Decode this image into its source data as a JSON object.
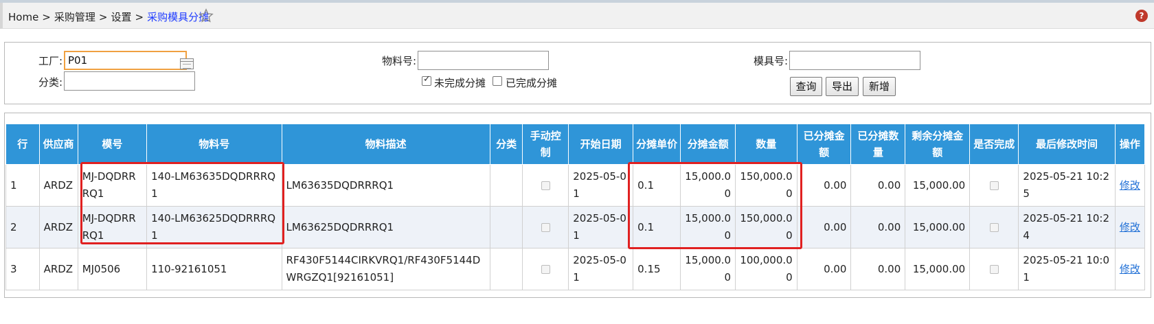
{
  "breadcrumb": {
    "items": [
      "Home",
      "采购管理",
      "设置"
    ],
    "current": "采购模具分摊",
    "separator": ">"
  },
  "filters": {
    "factory_label": "工厂:",
    "factory_value": "P01",
    "category_label": "分类:",
    "category_value": "",
    "material_label": "物料号:",
    "material_value": "",
    "mold_label": "模具号:",
    "mold_value": "",
    "unfinished_label": "未完成分摊",
    "unfinished_checked": true,
    "finished_label": "已完成分摊",
    "finished_checked": false
  },
  "buttons": {
    "query": "查询",
    "export": "导出",
    "add": "新增"
  },
  "table": {
    "headers": [
      "行",
      "供应商",
      "模号",
      "物料号",
      "物料描述",
      "分类",
      "手动控制",
      "开始日期",
      "分摊单价",
      "分摊金额",
      "数量",
      "已分摊金额",
      "已分摊数量",
      "剩余分摊金额",
      "是否完成",
      "最后修改时间",
      "操作"
    ],
    "rows": [
      {
        "row": "1",
        "supplier": "ARDZ",
        "mold": "MJ-DQDRRRQ1",
        "material": "140-LM63635DQDRRRQ1",
        "desc": "LM63635DQDRRRQ1",
        "category": "",
        "start": "2025-05-01",
        "unit_price": "0.1",
        "amount": "15,000.00",
        "qty": "150,000.00",
        "alloc_amount": "0.00",
        "alloc_qty": "0.00",
        "remain": "15,000.00",
        "modified": "2025-05-21 10:25",
        "action": "修改"
      },
      {
        "row": "2",
        "supplier": "ARDZ",
        "mold": "MJ-DQDRRRQ1",
        "material": "140-LM63625DQDRRRQ1",
        "desc": "LM63625DQDRRRQ1",
        "category": "",
        "start": "2025-05-01",
        "unit_price": "0.1",
        "amount": "15,000.00",
        "qty": "150,000.00",
        "alloc_amount": "0.00",
        "alloc_qty": "0.00",
        "remain": "15,000.00",
        "modified": "2025-05-21 10:24",
        "action": "修改"
      },
      {
        "row": "3",
        "supplier": "ARDZ",
        "mold": "MJ0506",
        "material": "110-92161051",
        "desc": "RF430F5144CIRKVRQ1/RF430F5144DWRGZQ1[92161051]",
        "category": "",
        "start": "2025-05-01",
        "unit_price": "0.15",
        "amount": "15,000.00",
        "qty": "100,000.00",
        "alloc_amount": "0.00",
        "alloc_qty": "0.00",
        "remain": "15,000.00",
        "modified": "2025-05-21 10:01",
        "action": "修改"
      }
    ]
  },
  "icons": {
    "star": "star-icon",
    "help": "help-icon",
    "calendar": "calendar-icon"
  },
  "colors": {
    "header_bg": "#2f95d8",
    "link": "#1f3cff",
    "highlight_border": "#e02020"
  }
}
